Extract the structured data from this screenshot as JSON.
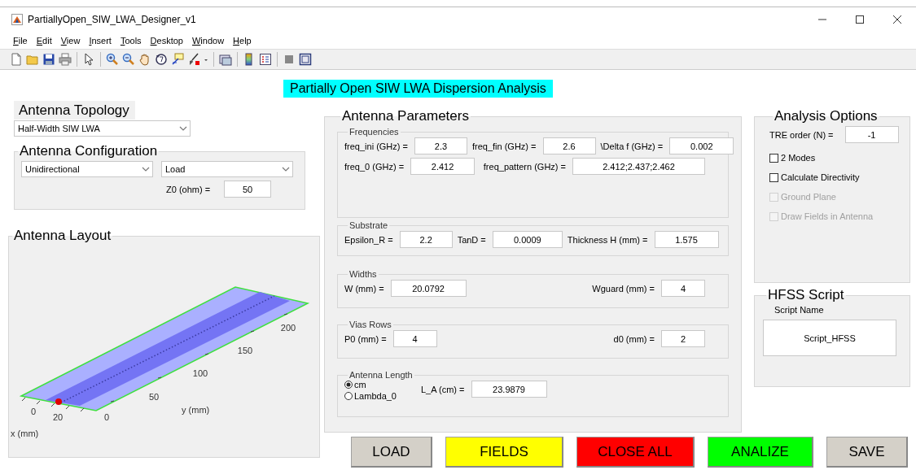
{
  "window": {
    "title": "PartiallyOpen_SIW_LWA_Designer_v1"
  },
  "menu": [
    {
      "label": "File"
    },
    {
      "label": "Edit"
    },
    {
      "label": "View"
    },
    {
      "label": "Insert"
    },
    {
      "label": "Tools"
    },
    {
      "label": "Desktop"
    },
    {
      "label": "Window"
    },
    {
      "label": "Help"
    }
  ],
  "heading": "Partially Open SIW LWA Dispersion Analysis",
  "topology": {
    "title": "Antenna Topology",
    "dropdown": "Half-Width SIW LWA"
  },
  "configuration": {
    "title": "Antenna Configuration",
    "dropdowns": [
      "Unidirectional",
      "Load"
    ],
    "fields": [
      {
        "label": "Z0 (ohm) =",
        "value": "50"
      }
    ]
  },
  "layout": {
    "title": "Antenna Layout",
    "x_label": "x (mm)",
    "y_label": "y (mm)",
    "x_ticks": [
      "0",
      "20"
    ],
    "y_ticks": [
      "0",
      "50",
      "100",
      "150",
      "200"
    ]
  },
  "parameters": {
    "title": "Antenna Parameters",
    "groups": [
      {
        "title": "Frequencies",
        "rows": [
          [
            {
              "label": "freq_ini (GHz) =",
              "value": "2.3"
            },
            {
              "label": "freq_fin (GHz) =",
              "value": "2.6"
            },
            {
              "label": "\\Delta f (GHz) =",
              "value": "0.002"
            }
          ],
          [
            {
              "label": "freq_0 (GHz) =",
              "value": "2.412"
            },
            {
              "label": "freq_pattern (GHz) =",
              "value": "2.412;2.437;2.462"
            }
          ]
        ]
      },
      {
        "title": "Substrate",
        "rows": [
          [
            {
              "label": "Epsilon_R =",
              "value": "2.2"
            },
            {
              "label": "TanD =",
              "value": "0.0009"
            },
            {
              "label": "Thickness H (mm) =",
              "value": "1.575"
            }
          ]
        ]
      },
      {
        "title": "Widths",
        "rows": [
          [
            {
              "label": "W (mm) =",
              "value": "20.0792"
            },
            {
              "label": "Wguard (mm) =",
              "value": "4"
            }
          ]
        ]
      },
      {
        "title": "Vias Rows",
        "rows": [
          [
            {
              "label": "P0 (mm) =",
              "value": "4"
            },
            {
              "label": "d0 (mm) =",
              "value": "2"
            }
          ]
        ]
      },
      {
        "title": "Antenna Length",
        "radios": [
          {
            "label": "cm",
            "selected": true
          },
          {
            "label": "Lambda_0",
            "selected": false
          }
        ],
        "rows": [
          [
            {
              "label": "L_A (cm) =",
              "value": "23.9879"
            }
          ]
        ]
      }
    ]
  },
  "analysis": {
    "title": "Analysis Options",
    "fields": [
      {
        "label": "TRE order (N) =",
        "value": "-1"
      }
    ],
    "checkboxes": [
      {
        "label": "2 Modes",
        "checked": false,
        "disabled": false
      },
      {
        "label": "Calculate Directivity",
        "checked": false,
        "disabled": false
      },
      {
        "label": "Ground Plane",
        "checked": false,
        "disabled": true
      },
      {
        "label": "Draw Fields in Antenna",
        "checked": false,
        "disabled": true
      }
    ]
  },
  "hfss": {
    "title": "HFSS Script",
    "label": "Script Name",
    "value": "Script_HFSS"
  },
  "buttons": [
    {
      "label": "LOAD",
      "color": "#d4d0c8"
    },
    {
      "label": "FIELDS",
      "color": "#ffff00"
    },
    {
      "label": "CLOSE ALL",
      "color": "#ff0000"
    },
    {
      "label": "ANALIZE",
      "color": "#00ff00"
    },
    {
      "label": "SAVE",
      "color": "#d4d0c8"
    }
  ]
}
